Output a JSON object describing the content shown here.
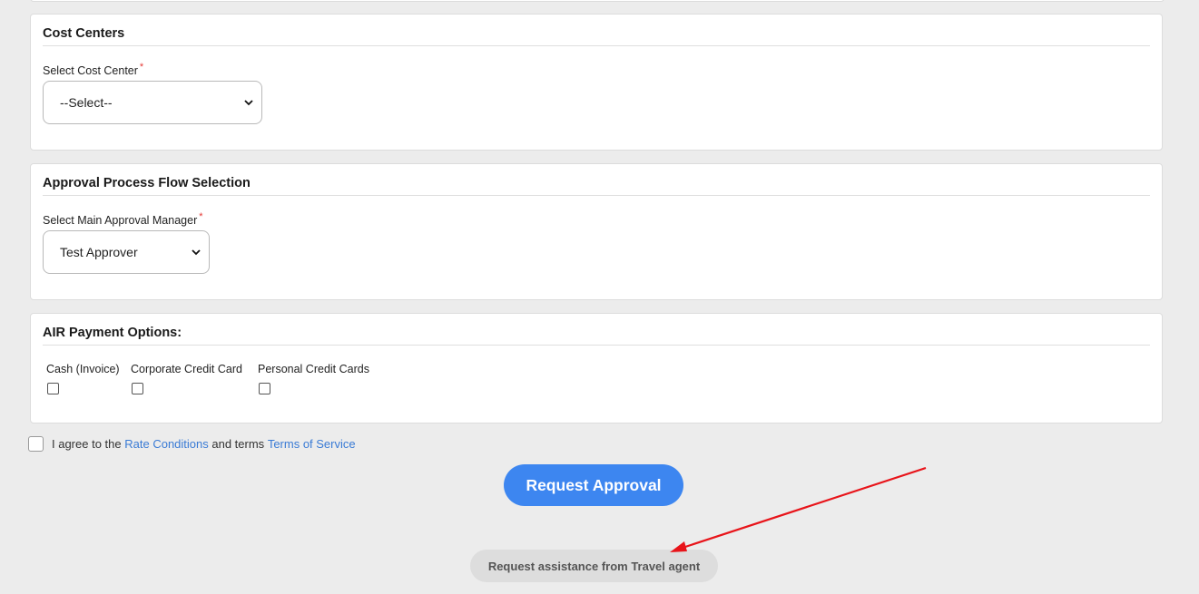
{
  "cost_centers": {
    "title": "Cost Centers",
    "label": "Select Cost Center",
    "required_mark": "*",
    "selected": "--Select--"
  },
  "approval": {
    "title": "Approval Process Flow Selection",
    "label": "Select Main Approval Manager",
    "required_mark": "*",
    "selected": "Test Approver"
  },
  "air_payment": {
    "title": "AIR Payment Options:",
    "options": [
      {
        "label": "Cash (Invoice)",
        "checked": false
      },
      {
        "label": "Corporate Credit Card",
        "checked": false
      },
      {
        "label": "Personal Credit Cards",
        "checked": false
      }
    ]
  },
  "agreement": {
    "prefix": "I agree to the",
    "rate_link": "Rate Conditions",
    "middle": "and terms",
    "tos_link": "Terms of Service",
    "checked": false
  },
  "buttons": {
    "request_approval": "Request Approval",
    "request_assistance": "Request assistance from Travel agent"
  },
  "colors": {
    "primary": "#3d86f0",
    "link": "#3a7bd5",
    "required": "#e53935",
    "annotation_arrow": "#e8141a"
  }
}
